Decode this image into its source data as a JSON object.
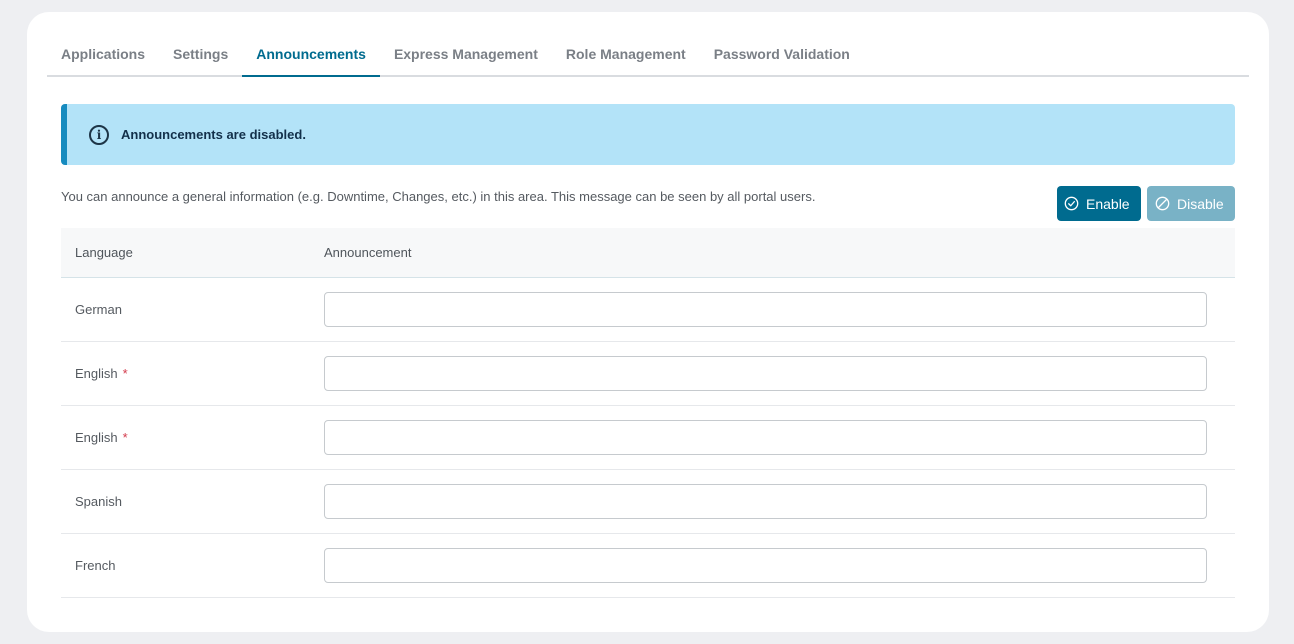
{
  "tabs": [
    {
      "label": "Applications",
      "active": false
    },
    {
      "label": "Settings",
      "active": false
    },
    {
      "label": "Announcements",
      "active": true
    },
    {
      "label": "Express Management",
      "active": false
    },
    {
      "label": "Role Management",
      "active": false
    },
    {
      "label": "Password Validation",
      "active": false
    }
  ],
  "alert": {
    "icon": "info-circle-icon",
    "text": "Announcements are disabled."
  },
  "description": "You can announce a general information (e.g. Downtime, Changes, etc.) in this area. This message can be seen by all portal users.",
  "buttons": {
    "enable_label": "Enable",
    "disable_label": "Disable",
    "icon": "check-circle-icon"
  },
  "table": {
    "headers": {
      "language": "Language",
      "announcement": "Announcement"
    },
    "rows": [
      {
        "language": "German",
        "required": false,
        "required_mark": "",
        "value": ""
      },
      {
        "language": "English",
        "required": true,
        "required_mark": "*",
        "value": ""
      },
      {
        "language": "English",
        "required": true,
        "required_mark": "*",
        "value": ""
      },
      {
        "language": "Spanish",
        "required": false,
        "required_mark": "",
        "value": ""
      },
      {
        "language": "French",
        "required": false,
        "required_mark": "",
        "value": ""
      }
    ]
  },
  "colors": {
    "accent": "#006b8f",
    "alert_bg": "#b3e3f8",
    "alert_border": "#168bbf",
    "disabled_button": "#79b2c6",
    "required": "#d2384a"
  }
}
